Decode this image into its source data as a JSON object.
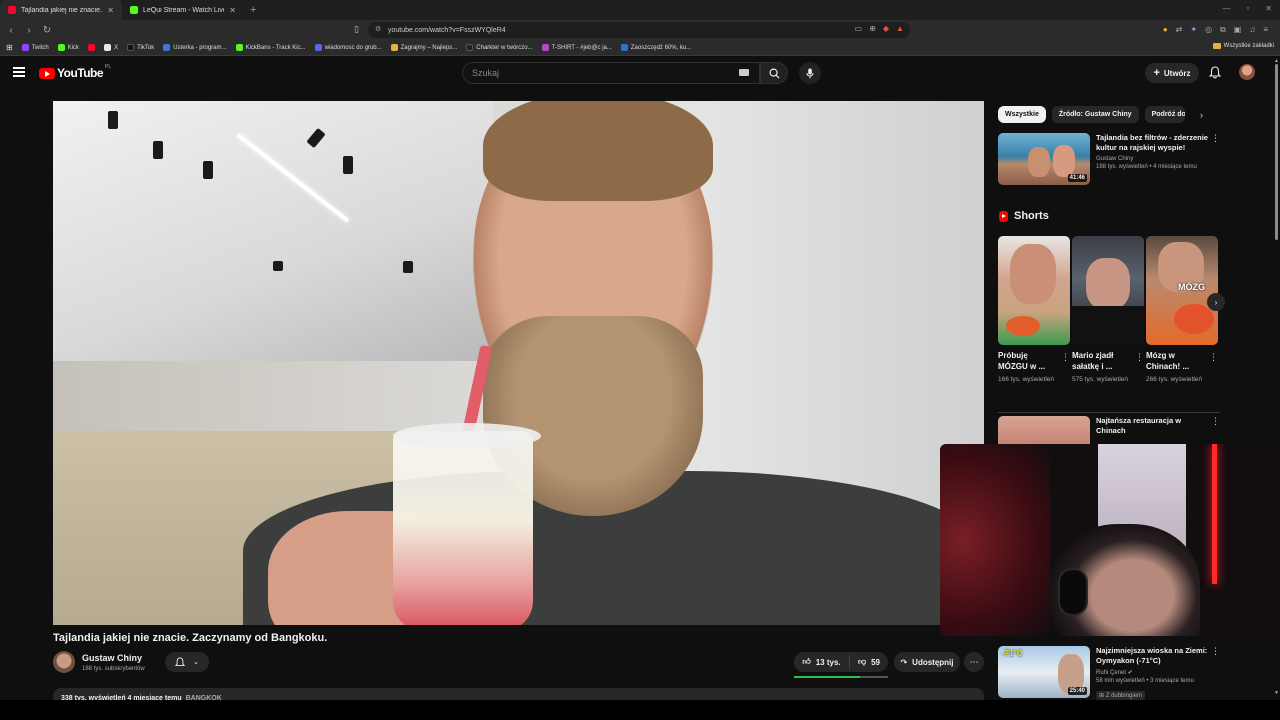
{
  "browser": {
    "tabs": [
      {
        "title": "Tajlandia jakiej nie znacie. Za",
        "active": true,
        "favicon_color": "#ff0033"
      },
      {
        "title": "LeQui Stream - Watch Live on Kick",
        "active": false,
        "favicon_color": "#53fc18"
      }
    ],
    "new_tab": "+",
    "url": "youtube.com/watch?v=FsszWYQleR4",
    "bookmarks": [
      {
        "label": "Twitch",
        "color": "#9146ff"
      },
      {
        "label": "Kick",
        "color": "#53fc18"
      },
      {
        "label": "",
        "color": "#ff0033"
      },
      {
        "label": "X",
        "color": "#e7e7e7"
      },
      {
        "label": "TikTok",
        "color": "#111111"
      },
      {
        "label": "Usterka - program...",
        "color": "#3b7bd6"
      },
      {
        "label": "KickBans - Track Kic...",
        "color": "#53fc18"
      },
      {
        "label": "wiadomosc do grub...",
        "color": "#5865f2"
      },
      {
        "label": "Zagrajmy – Najleps...",
        "color": "#e3b341"
      },
      {
        "label": "Charkter w twórczo...",
        "color": "#222222"
      },
      {
        "label": "T-SHIRT - #jeb@c ja...",
        "color": "#b04cc4"
      },
      {
        "label": "Zaoszczędź 60%, ku...",
        "color": "#2f6fdd"
      }
    ],
    "all_bookmarks": "Wszystkie zakładki"
  },
  "yt": {
    "logo_text": "YouTube",
    "country": "PL",
    "search_placeholder": "Szukaj",
    "create_label": "Utwórz"
  },
  "video": {
    "title": "Tajlandia jakiej nie znacie. Zaczynamy od Bangkoku.",
    "channel": "Gustaw Chiny",
    "subscribers": "188 tys. subskrybentów",
    "likes": "13 tys.",
    "dislikes": "59",
    "like_ratio": 0.7,
    "share_label": "Udostępnij",
    "more": "⋯",
    "desc_meta": "338 tys. wyświetleń  4 miesiące temu",
    "desc_tag": "BANGKOK"
  },
  "sidebar": {
    "chips": [
      {
        "label": "Wszystkie",
        "active": true
      },
      {
        "label": "Źródło: Gustaw Chiny",
        "active": false
      },
      {
        "label": "Podróż do",
        "active": false
      }
    ],
    "recommendations": [
      {
        "title": "Tajlandia bez filtrów - zderzenie kultur na rajskiej wyspie!",
        "channel": "Gustaw Chiny",
        "meta": "188 tys. wyświetleń • 4 miesiące temu",
        "duration": "41:46"
      },
      {
        "title": "Najtańsza restauracja w Chinach",
        "channel": "",
        "meta": "",
        "duration": ""
      },
      {
        "title": "Najzimniejsza wioska na Ziemi: Oymyakon (-71°C)",
        "channel": "Ruhi Çenet",
        "meta": "58 mln wyświetleń • 3 miesiące temu",
        "duration": "25:40",
        "badge": "Z dubbingiem",
        "thumb_text": "-71°C"
      }
    ],
    "shorts_title": "Shorts",
    "shorts": [
      {
        "title": "Próbuję MÓZGU w ...",
        "views": "166 tys. wyświetleń"
      },
      {
        "title": "Mario zjadł sałatkę i ...",
        "views": "575 tys. wyświetleń"
      },
      {
        "title": "Mózg w Chinach! ...",
        "views": "266 tys. wyświetleń",
        "overlay": "MÓZG"
      }
    ]
  }
}
